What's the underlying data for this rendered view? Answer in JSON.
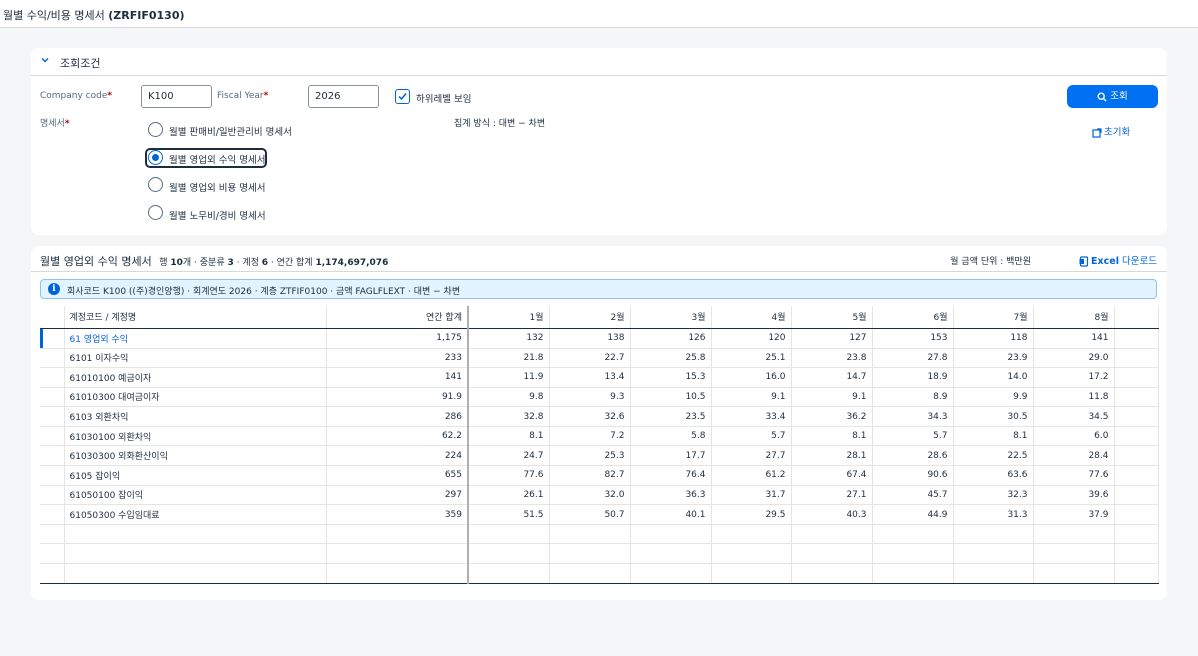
{
  "window": {
    "title_plain": "월별 수익/비용 명세서",
    "title_code": "(ZRFIF0130)"
  },
  "filter": {
    "section_label": "조회조건",
    "company_code_label": "Company code",
    "company_code_value": "K100",
    "fiscal_year_label": "Fiscal Year",
    "fiscal_year_value": "2026",
    "sublevel_label": "하위레벨 보임",
    "statement_label": "명세서",
    "required_mark": "*",
    "options": [
      {
        "label": "월별 판매비/일반관리비 명세서",
        "selected": false
      },
      {
        "label": "월별 영업외 수익 명세서",
        "selected": true
      },
      {
        "label": "월별 영업외 비용 명세서",
        "selected": false
      },
      {
        "label": "월별 노무비/경비 명세서",
        "selected": false
      }
    ],
    "aggregation_text": "집계 방식 : 대변 − 차변",
    "search_button": "조회",
    "reset_link": "초기화"
  },
  "report": {
    "title": "월별 영업외 수익 명세서",
    "summary_parts": [
      "행 ",
      "10",
      "개 · 중분류 ",
      "3",
      " · 계정 ",
      "6",
      " · 연간 합계 ",
      "1,174,697,076"
    ],
    "unit_text": "월 금액 단위 : 백만원",
    "excel_bold": "Excel",
    "excel_rest": "다운로드",
    "info_text": "회사코드 K100 ((주)경인양행) · 회계연도 2026 · 계층 ZTFIF0100 · 금액 FAGLFLEXT · 대변 − 차변",
    "columns": [
      "계정코드 / 계정명",
      "연간 합계",
      "1월",
      "2월",
      "3월",
      "4월",
      "5월",
      "6월",
      "7월",
      "8월"
    ],
    "rows": [
      [
        "61 영업외 수익",
        "1,175",
        "132",
        "138",
        "126",
        "120",
        "127",
        "153",
        "118",
        "141"
      ],
      [
        "6101 이자수익",
        "233",
        "21.8",
        "22.7",
        "25.8",
        "25.1",
        "23.8",
        "27.8",
        "23.9",
        "29.0"
      ],
      [
        "61010100 예금이자",
        "141",
        "11.9",
        "13.4",
        "15.3",
        "16.0",
        "14.7",
        "18.9",
        "14.0",
        "17.2"
      ],
      [
        "61010300 대여금이자",
        "91.9",
        "9.8",
        "9.3",
        "10.5",
        "9.1",
        "9.1",
        "8.9",
        "9.9",
        "11.8"
      ],
      [
        "6103 외환차익",
        "286",
        "32.8",
        "32.6",
        "23.5",
        "33.4",
        "36.2",
        "34.3",
        "30.5",
        "34.5"
      ],
      [
        "61030100 외환차익",
        "62.2",
        "8.1",
        "7.2",
        "5.8",
        "5.7",
        "8.1",
        "5.7",
        "8.1",
        "6.0"
      ],
      [
        "61030300 외화환산이익",
        "224",
        "24.7",
        "25.3",
        "17.7",
        "27.7",
        "28.1",
        "28.6",
        "22.5",
        "28.4"
      ],
      [
        "6105 잡이익",
        "655",
        "77.6",
        "82.7",
        "76.4",
        "61.2",
        "67.4",
        "90.6",
        "63.6",
        "77.6"
      ],
      [
        "61050100 잡이익",
        "297",
        "26.1",
        "32.0",
        "36.3",
        "31.7",
        "27.1",
        "45.7",
        "32.3",
        "39.6"
      ],
      [
        "61050300 수입임대료",
        "359",
        "51.5",
        "50.7",
        "40.1",
        "29.5",
        "40.3",
        "44.9",
        "31.3",
        "37.9"
      ]
    ],
    "selected_row": 0
  },
  "colors": {
    "accent": "#0070f2",
    "link": "#0064d9",
    "info_bg": "#e1f4ff"
  }
}
